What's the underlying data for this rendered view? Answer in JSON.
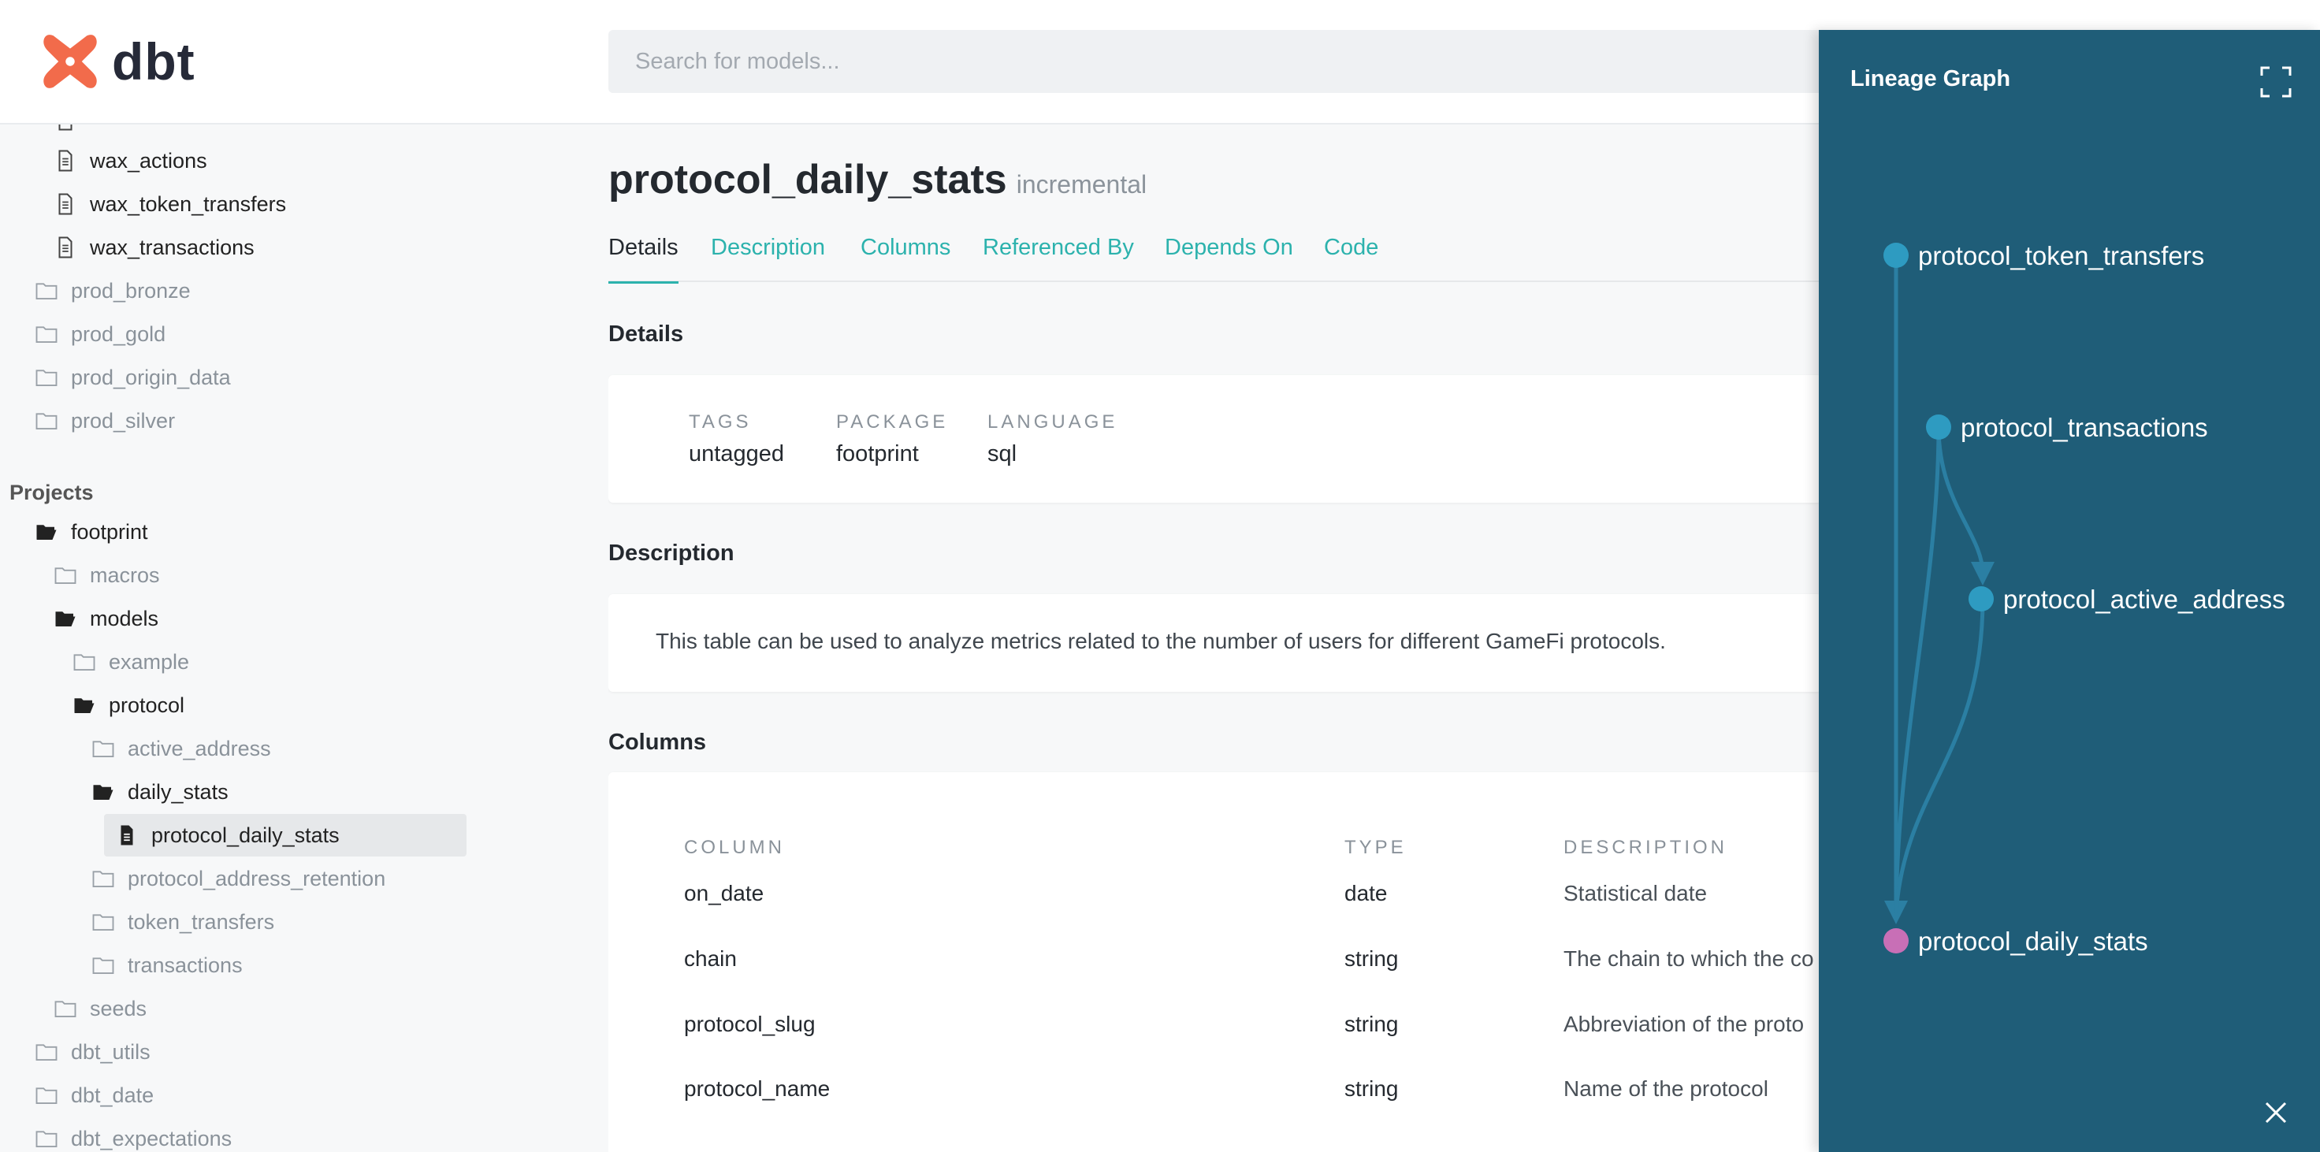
{
  "app": {
    "logo_text": "dbt"
  },
  "search": {
    "placeholder": "Search for models..."
  },
  "sidebar": {
    "items_top": [
      {
        "label": "wax_actions",
        "type": "file"
      },
      {
        "label": "wax_token_transfers",
        "type": "file"
      },
      {
        "label": "wax_transactions",
        "type": "file"
      },
      {
        "label": "prod_bronze",
        "type": "folder"
      },
      {
        "label": "prod_gold",
        "type": "folder"
      },
      {
        "label": "prod_origin_data",
        "type": "folder"
      },
      {
        "label": "prod_silver",
        "type": "folder"
      }
    ],
    "projects_title": "Projects",
    "project_items": [
      {
        "label": "footprint",
        "type": "folder-open"
      },
      {
        "label": "macros",
        "type": "folder"
      },
      {
        "label": "models",
        "type": "folder-open"
      },
      {
        "label": "example",
        "type": "folder"
      },
      {
        "label": "protocol",
        "type": "folder-open"
      },
      {
        "label": "active_address",
        "type": "folder"
      },
      {
        "label": "daily_stats",
        "type": "folder-open"
      },
      {
        "label": "protocol_daily_stats",
        "type": "file-active"
      },
      {
        "label": "protocol_address_retention",
        "type": "folder"
      },
      {
        "label": "token_transfers",
        "type": "folder"
      },
      {
        "label": "transactions",
        "type": "folder"
      },
      {
        "label": "seeds",
        "type": "folder"
      },
      {
        "label": "dbt_utils",
        "type": "folder"
      },
      {
        "label": "dbt_date",
        "type": "folder"
      },
      {
        "label": "dbt_expectations",
        "type": "folder"
      }
    ]
  },
  "model": {
    "name": "protocol_daily_stats",
    "materialization": "incremental",
    "tabs": [
      "Details",
      "Description",
      "Columns",
      "Referenced By",
      "Depends On",
      "Code"
    ],
    "active_tab": "Details"
  },
  "details": {
    "heading": "Details",
    "tags_label": "TAGS",
    "tags_value": "untagged",
    "package_label": "PACKAGE",
    "package_value": "footprint",
    "language_label": "LANGUAGE",
    "language_value": "sql"
  },
  "description": {
    "heading": "Description",
    "text": "This table can be used to analyze metrics related to the number of users for different GameFi protocols."
  },
  "columns": {
    "heading": "Columns",
    "headers": {
      "column": "COLUMN",
      "type": "TYPE",
      "description": "DESCRIPTION"
    },
    "rows": [
      {
        "name": "on_date",
        "type": "date",
        "description": "Statistical date"
      },
      {
        "name": "chain",
        "type": "string",
        "description": "The chain to which the co"
      },
      {
        "name": "protocol_slug",
        "type": "string",
        "description": "Abbreviation of the proto"
      },
      {
        "name": "protocol_name",
        "type": "string",
        "description": "Name of the protocol"
      }
    ]
  },
  "lineage": {
    "title": "Lineage Graph",
    "nodes": [
      {
        "label": "protocol_token_transfers",
        "color": "#2e9bc1"
      },
      {
        "label": "protocol_transactions",
        "color": "#2e9bc1"
      },
      {
        "label": "protocol_active_address",
        "color": "#2e9bc1"
      },
      {
        "label": "protocol_daily_stats",
        "color": "#c86fb6"
      }
    ]
  },
  "colors": {
    "accent": "#2cb2ad",
    "brand": "#f26b4b",
    "lineage_bg": "#1f5d78"
  }
}
